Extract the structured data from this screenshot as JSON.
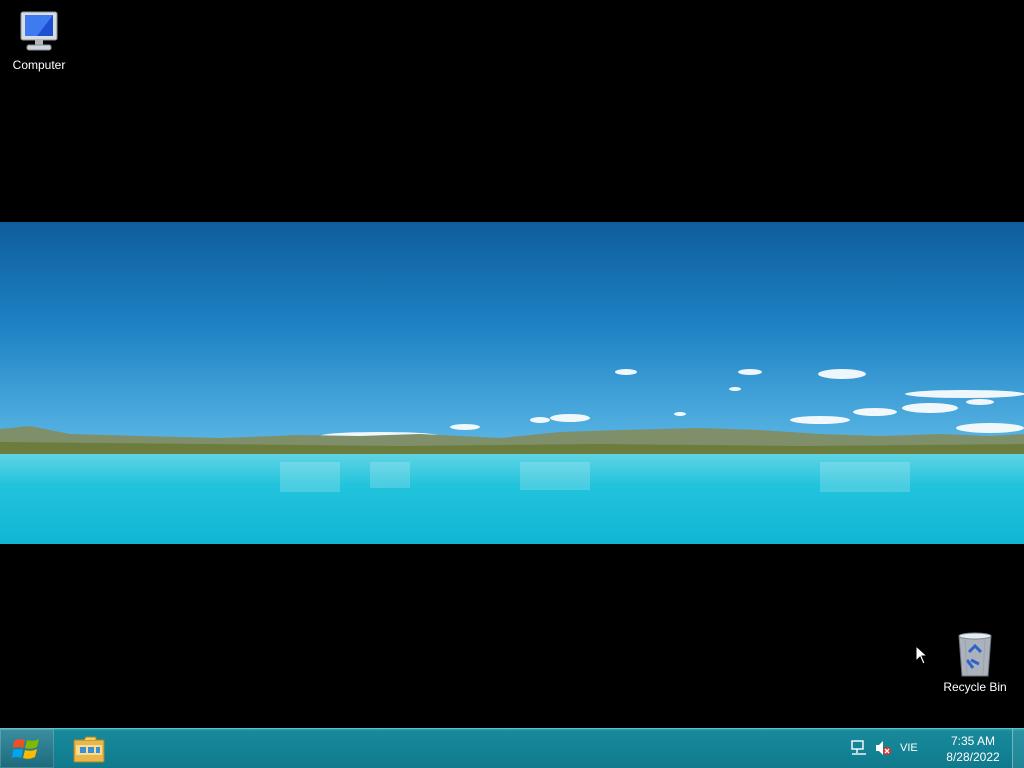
{
  "desktop": {
    "icons": [
      {
        "label": "Computer",
        "icon": "computer-icon"
      },
      {
        "label": "Recycle Bin",
        "icon": "recycle-bin-icon"
      }
    ]
  },
  "taskbar": {
    "start_icon": "windows-logo-icon",
    "pinned": [
      {
        "icon": "file-explorer-icon"
      }
    ],
    "tray": {
      "network_icon": "network-icon",
      "volume_icon": "volume-muted-icon",
      "language": "VIE",
      "time": "7:35 AM",
      "date": "8/28/2022"
    }
  },
  "colors": {
    "taskbar": "#138396",
    "desktop_background": "#000000",
    "sky": "#1e7fc0",
    "water": "#1ec8dc"
  }
}
